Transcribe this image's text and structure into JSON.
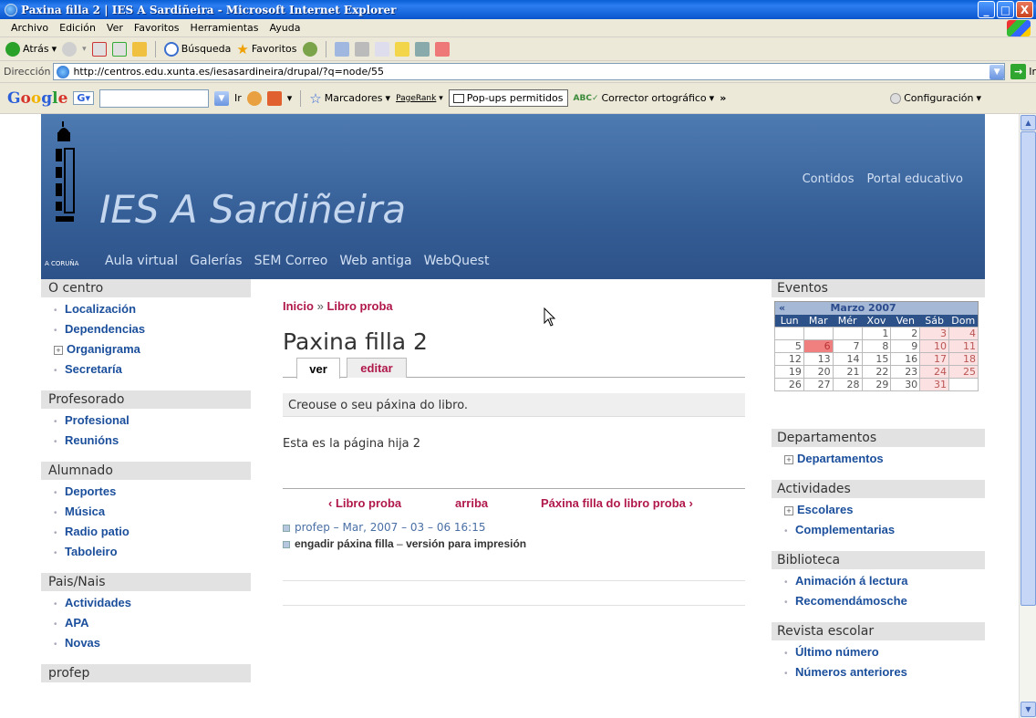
{
  "window": {
    "title": "Paxina filla 2 | IES A Sardiñeira - Microsoft Internet Explorer",
    "buttons": {
      "minimize": "_",
      "maximize": "□",
      "close": "X"
    }
  },
  "menubar": [
    "Archivo",
    "Edición",
    "Ver",
    "Favoritos",
    "Herramientas",
    "Ayuda"
  ],
  "toolbar": {
    "back": "Atrás",
    "search": "Búsqueda",
    "favorites": "Favoritos"
  },
  "address": {
    "label": "Dirección",
    "url": "http://centros.edu.xunta.es/iesasardineira/drupal/?q=node/55",
    "go": "Ir"
  },
  "googlebar": {
    "logo": "Google",
    "g_label": "G",
    "go": "Ir",
    "bookmarks": "Marcadores",
    "pagerank": "PageRank",
    "popups": "Pop-ups permitidos",
    "spell": "Corrector ortográfico",
    "more": "»",
    "config": "Configuración"
  },
  "site": {
    "name": "IES A Sardiñeira",
    "logo_caption": "A CORUÑA",
    "primary_links": [
      "Aula virtual",
      "Galerías",
      "SEM Correo",
      "Web antiga",
      "WebQuest"
    ],
    "secondary_links": [
      "Contidos",
      "Portal educativo"
    ]
  },
  "sidebar_left": [
    {
      "title": "O centro",
      "items": [
        {
          "label": "Localización",
          "expand": false
        },
        {
          "label": "Dependencias",
          "expand": false
        },
        {
          "label": "Organigrama",
          "expand": true
        },
        {
          "label": "Secretaría",
          "expand": false
        }
      ]
    },
    {
      "title": "Profesorado",
      "items": [
        {
          "label": "Profesional",
          "expand": false
        },
        {
          "label": "Reunións",
          "expand": false
        }
      ]
    },
    {
      "title": "Alumnado",
      "items": [
        {
          "label": "Deportes",
          "expand": false
        },
        {
          "label": "Música",
          "expand": false
        },
        {
          "label": "Radio patio",
          "expand": false
        },
        {
          "label": "Taboleiro",
          "expand": false
        }
      ]
    },
    {
      "title": "Pais/Nais",
      "items": [
        {
          "label": "Actividades",
          "expand": false
        },
        {
          "label": "APA",
          "expand": false
        },
        {
          "label": "Novas",
          "expand": false
        }
      ]
    },
    {
      "title": "profep",
      "items": []
    }
  ],
  "main": {
    "breadcrumb": [
      "Inicio",
      "Libro proba"
    ],
    "breadcrumb_sep": "»",
    "title": "Paxina filla 2",
    "tabs": [
      "ver",
      "editar"
    ],
    "status": "Creouse o seu páxina do libro.",
    "body": "Esta es la página hija 2",
    "book_nav": {
      "prev": "‹ Libro proba",
      "up": "arriba",
      "next": "Páxina filla do libro proba ›"
    },
    "meta": "profep – Mar, 2007 – 03 – 06 16:15",
    "links": [
      "engadir páxina filla",
      "versión para impresión"
    ],
    "links_sep": "–"
  },
  "sidebar_right": {
    "events_title": "Eventos",
    "calendar": {
      "prev": "«",
      "month": "Marzo 2007",
      "days": [
        "Lun",
        "Mar",
        "Mér",
        "Xov",
        "Ven",
        "Sáb",
        "Dom"
      ],
      "weeks": [
        [
          "",
          "",
          "",
          "1",
          "2",
          "3",
          "4"
        ],
        [
          "5",
          "6",
          "7",
          "8",
          "9",
          "10",
          "11"
        ],
        [
          "12",
          "13",
          "14",
          "15",
          "16",
          "17",
          "18"
        ],
        [
          "19",
          "20",
          "21",
          "22",
          "23",
          "24",
          "25"
        ],
        [
          "26",
          "27",
          "28",
          "29",
          "30",
          "31",
          ""
        ]
      ],
      "today": "6"
    },
    "blocks": [
      {
        "title": "Departamentos",
        "items": [
          {
            "label": "Departamentos",
            "expand": true
          }
        ]
      },
      {
        "title": "Actividades",
        "items": [
          {
            "label": "Escolares",
            "expand": true
          },
          {
            "label": "Complementarias",
            "expand": false
          }
        ]
      },
      {
        "title": "Biblioteca",
        "items": [
          {
            "label": "Animación á lectura",
            "expand": false
          },
          {
            "label": "Recomendámosche",
            "expand": false
          }
        ]
      },
      {
        "title": "Revista escolar",
        "items": [
          {
            "label": "Último número",
            "expand": false
          },
          {
            "label": "Números anteriores",
            "expand": false
          }
        ]
      }
    ]
  },
  "colors": {
    "header": "#365f97",
    "link": "#1b4f9c",
    "accent": "#b0184a"
  }
}
